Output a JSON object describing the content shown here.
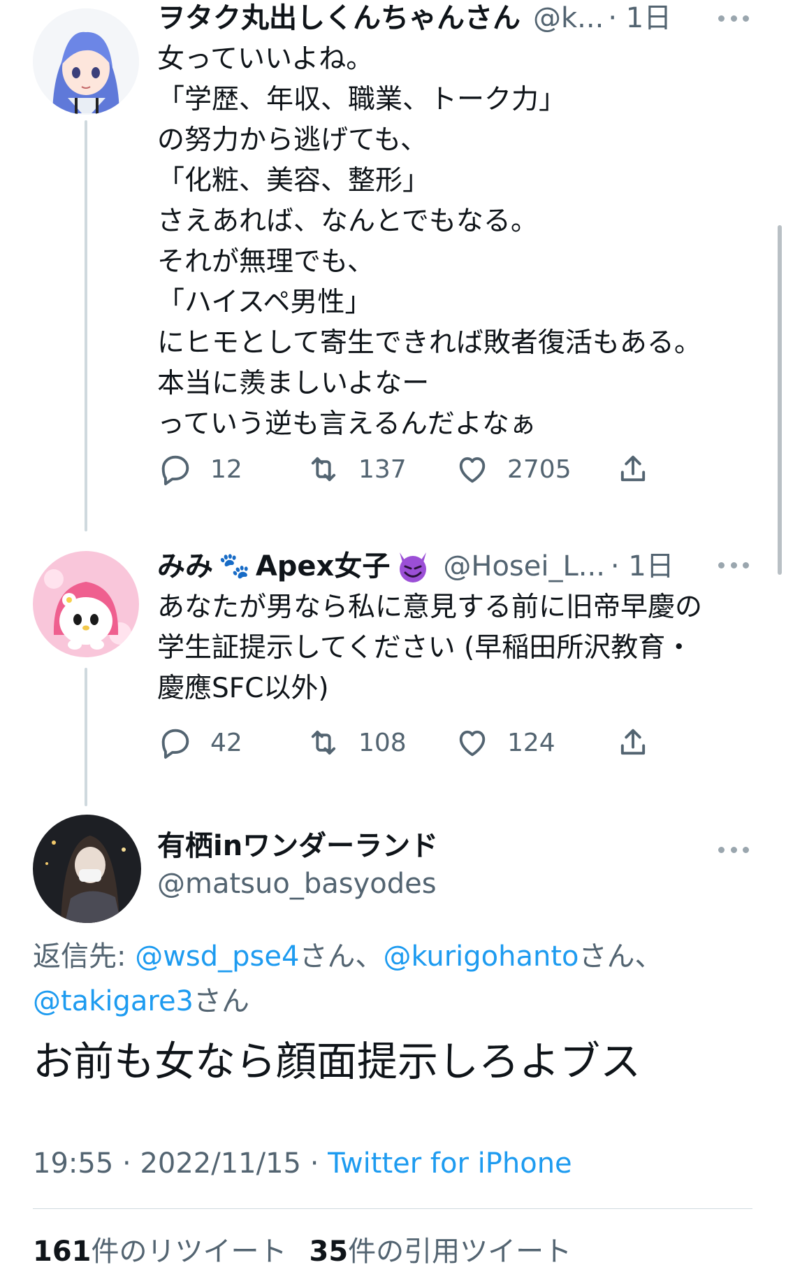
{
  "tweet1": {
    "name": "ヲタク丸出しくんちゃんさん",
    "handle": "@k...",
    "time": "· 1日",
    "text": "女っていいよね。\n「学歴、年収、職業、トーク力」\nの努力から逃げても、\n「化粧、美容、整形」\nさえあれば、なんとでもなる。\nそれが無理でも、\n「ハイスペ男性」\nにヒモとして寄生できれば敗者復活もある。\n本当に羨ましいよなー\nっていう逆も言えるんだよなぁ",
    "replies": "12",
    "retweets": "137",
    "likes": "2705"
  },
  "tweet2": {
    "name_prefix": "みみ",
    "name_suffix": "Apex女子",
    "emoji_paw": "🐾",
    "emoji_devil": "😈",
    "handle": "@Hosei_L...",
    "time": "· 1日",
    "text": "あなたが男なら私に意見する前に旧帝早慶の\n学生証提示してください (早稲田所沢教育・\n慶應SFC以外)",
    "replies": "42",
    "retweets": "108",
    "likes": "124"
  },
  "main_tweet": {
    "name": "有栖inワンダーランド",
    "handle": "@matsuo_basyodes",
    "reply_prefix": "返信先:",
    "reply_to": [
      "@wsd_pse4",
      "@kurigohanto",
      "@takigare3"
    ],
    "san_comma": "さん、",
    "san": "さん",
    "text": "お前も女なら顔面提示しろよブス",
    "time": "19:55",
    "date": "2022/11/15",
    "source": "Twitter for iPhone",
    "retweet_count": "161",
    "retweet_label": "件のリツイート",
    "quote_count": "35",
    "quote_label": "件の引用ツイート"
  },
  "colors": {
    "link": "#1d9bf0",
    "muted": "#536471",
    "thread_line": "#cfd9de"
  },
  "icons": [
    "reply-icon",
    "retweet-icon",
    "like-icon",
    "share-icon",
    "more-icon"
  ]
}
